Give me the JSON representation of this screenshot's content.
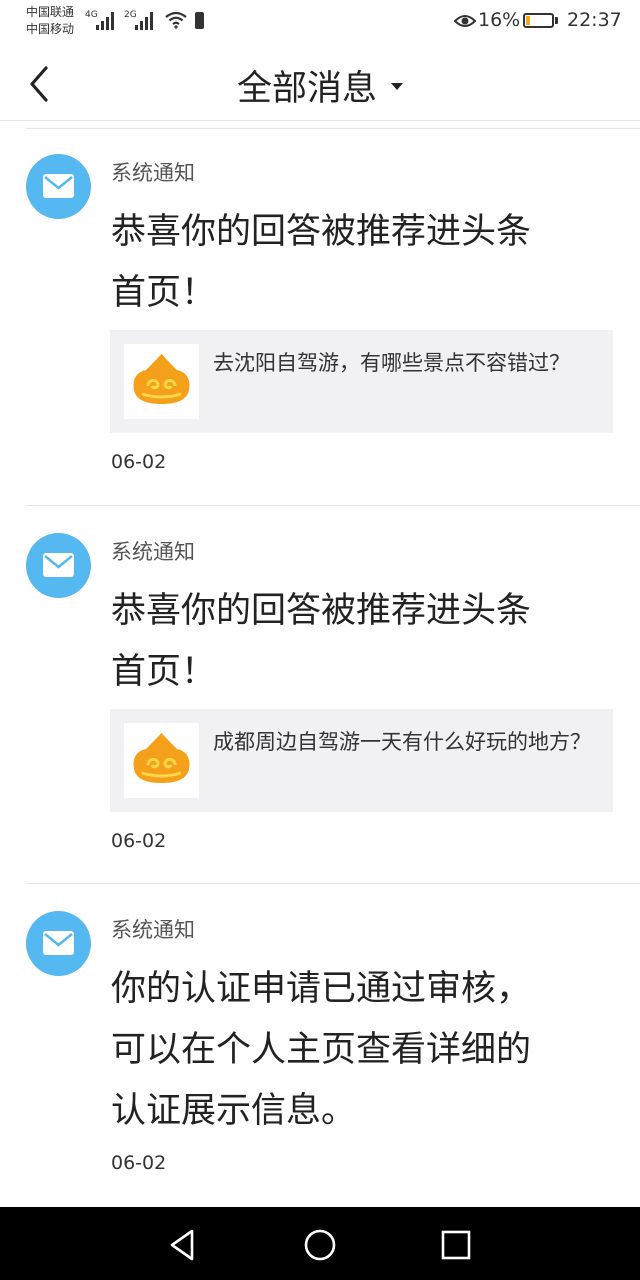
{
  "status": {
    "carrier1": "中国联通",
    "carrier2": "中国移动",
    "net1": "4G",
    "net2": "2G",
    "battery_pct": "16%",
    "battery_level": 0.16,
    "battery_color": "#f5a623",
    "time": "22:37"
  },
  "header": {
    "title": "全部消息",
    "back_icon": "chevron-left-icon",
    "dropdown_icon": "caret-down-icon"
  },
  "messages": [
    {
      "sender": "系统通知",
      "line1": "恭喜你的回答被推荐进头条",
      "line2": "首页！",
      "card_text": "去沈阳自驾游，有哪些景点不容错过？",
      "date": "06-02"
    },
    {
      "sender": "系统通知",
      "line1": "恭喜你的回答被推荐进头条",
      "line2": "首页！",
      "card_text": "成都周边自驾游一天有什么好玩的地方？",
      "date": "06-02"
    },
    {
      "sender": "系统通知",
      "line1": "你的认证申请已通过审核，",
      "line2": "可以在个人主页查看详细的",
      "line3": "认证展示信息。",
      "date": "06-02"
    }
  ],
  "colors": {
    "avatar_bg": "#55b8f0",
    "card_bg": "#f1f1f3",
    "logo_orange": "#f5a01a",
    "logo_yellow": "#ffd84a"
  }
}
